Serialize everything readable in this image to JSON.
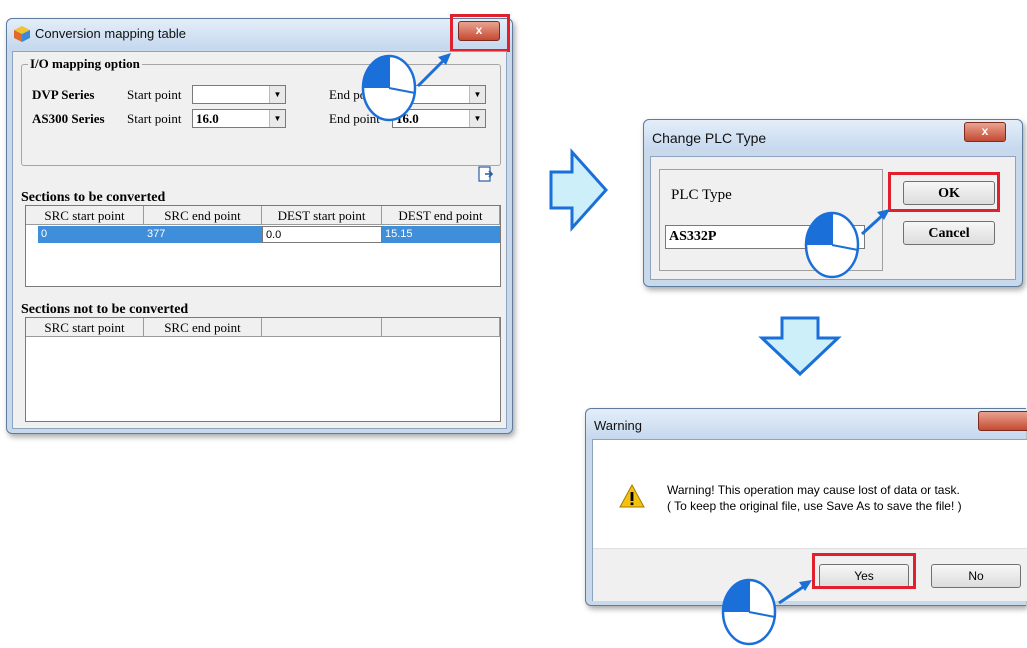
{
  "conversion_window": {
    "title": "Conversion mapping table",
    "close_label": "x",
    "io_group_label": "I/O mapping option",
    "rows": [
      {
        "series": "DVP Series",
        "start_label": "Start point",
        "start_value": "",
        "end_label": "End point",
        "end_value": ""
      },
      {
        "series": "AS300 Series",
        "start_label": "Start point",
        "start_value": "16.0",
        "end_label": "End point",
        "end_value": "16.0"
      }
    ],
    "to_convert": {
      "heading": "Sections to be converted",
      "columns": [
        "SRC start point",
        "SRC end point",
        "DEST start point",
        "DEST end point"
      ],
      "rows": [
        {
          "src_start": "0",
          "src_end": "377",
          "dest_start": "0.0",
          "dest_end": "15.15"
        }
      ]
    },
    "not_convert": {
      "heading": "Sections not to be converted",
      "columns": [
        "SRC start point",
        "SRC end point",
        "",
        ""
      ]
    }
  },
  "plc_window": {
    "title": "Change PLC Type",
    "close_label": "x",
    "field_label": "PLC Type",
    "field_value": "AS332P",
    "ok_label": "OK",
    "cancel_label": "Cancel"
  },
  "warning_window": {
    "title": "Warning",
    "line1": "Warning! This operation may cause lost of data or task.",
    "line2": "( To keep the original file, use Save As to save the file! )",
    "yes_label": "Yes",
    "no_label": "No"
  },
  "colors": {
    "highlight_box": "#e0202c",
    "flow_arrow": "#1a6fd8",
    "selection": "#3e8ed9"
  },
  "icons": [
    "app-cube-icon",
    "export-icon",
    "warning-triangle-icon",
    "flow-arrow-right-icon",
    "flow-arrow-down-icon",
    "mouse-click-icon"
  ]
}
